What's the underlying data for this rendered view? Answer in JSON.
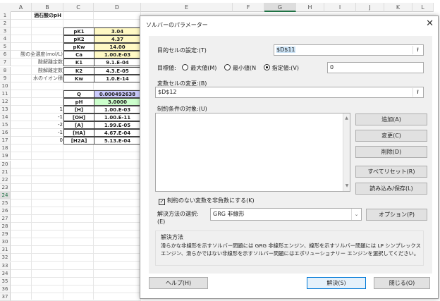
{
  "sheet": {
    "columns": [
      "A",
      "B",
      "C",
      "D",
      "E",
      "F",
      "G",
      "H",
      "I",
      "J",
      "K",
      "L"
    ],
    "title": "酒石酸のpH",
    "labels": {
      "r6": "酸の全濃度(mol/L)",
      "r7": "酸解離定数",
      "r8": "酸解離定数",
      "r9": "水のイオン積"
    },
    "params": [
      {
        "name": "pK1",
        "value": "3.04"
      },
      {
        "name": "pK2",
        "value": "4.37"
      },
      {
        "name": "pKw",
        "value": "14.00"
      },
      {
        "name": "Ca",
        "value": "1.00.E-03"
      },
      {
        "name": "K1",
        "value": "9.1.E-04"
      },
      {
        "name": "K2",
        "value": "4.3.E-05"
      },
      {
        "name": "Kw",
        "value": "1.0.E-14"
      }
    ],
    "results": [
      {
        "coef": "",
        "name": "Q",
        "value": "0.000492638"
      },
      {
        "coef": "",
        "name": "pH",
        "value": "3.0000"
      },
      {
        "coef": "1",
        "name": "[H]",
        "value": "1.00.E-03"
      },
      {
        "coef": "-1",
        "name": "[OH]",
        "value": "1.00.E-11"
      },
      {
        "coef": "-2",
        "name": "[A]",
        "value": "1.99.E-05"
      },
      {
        "coef": "-1",
        "name": "[HA]",
        "value": "4.67.E-04"
      },
      {
        "coef": "0",
        "name": "[H2A]",
        "value": "5.13.E-04"
      }
    ],
    "colors": {
      "yellow": "#fff9c4",
      "purple": "#ccccff",
      "green": "#ccffcc",
      "selected_row": "24"
    }
  },
  "dialog": {
    "title": "ソルバーのパラメーター",
    "objective_label": "目的セルの設定:(T)",
    "objective_value": "$D$11",
    "target_label": "目標値:",
    "max_label": "最大値(M)",
    "min_label": "最小値(N",
    "value_of_label": "指定値:(V)",
    "value_of": "0",
    "changing_label": "変数セルの変更:(B)",
    "changing_value": "$D$12",
    "constraints_label": "制約条件の対象:(U)",
    "add": "追加(A)",
    "change": "変更(C)",
    "delete": "削除(D)",
    "reset_all": "すべてリセット(R)",
    "load_save": "読み込み/保存(L)",
    "nonneg_label": "制約のない変数を非負数にする(K)",
    "method_label": "解決方法の選択:",
    "method_label2": "(E)",
    "method_value": "GRG 非線形",
    "options": "オプション(P)",
    "group_title": "解決方法",
    "group_text": "滑らかな非線形を示すソルバー問題には GRG 非線形エンジン、線形を示すソルバー問題には LP シンプレックス エンジン、滑らかではない非線形を示すソルバー問題にはエボリューショナリー エンジンを選択してください。",
    "help": "ヘルプ(H)",
    "solve": "解決(S)",
    "close": "閉じる(O)"
  }
}
